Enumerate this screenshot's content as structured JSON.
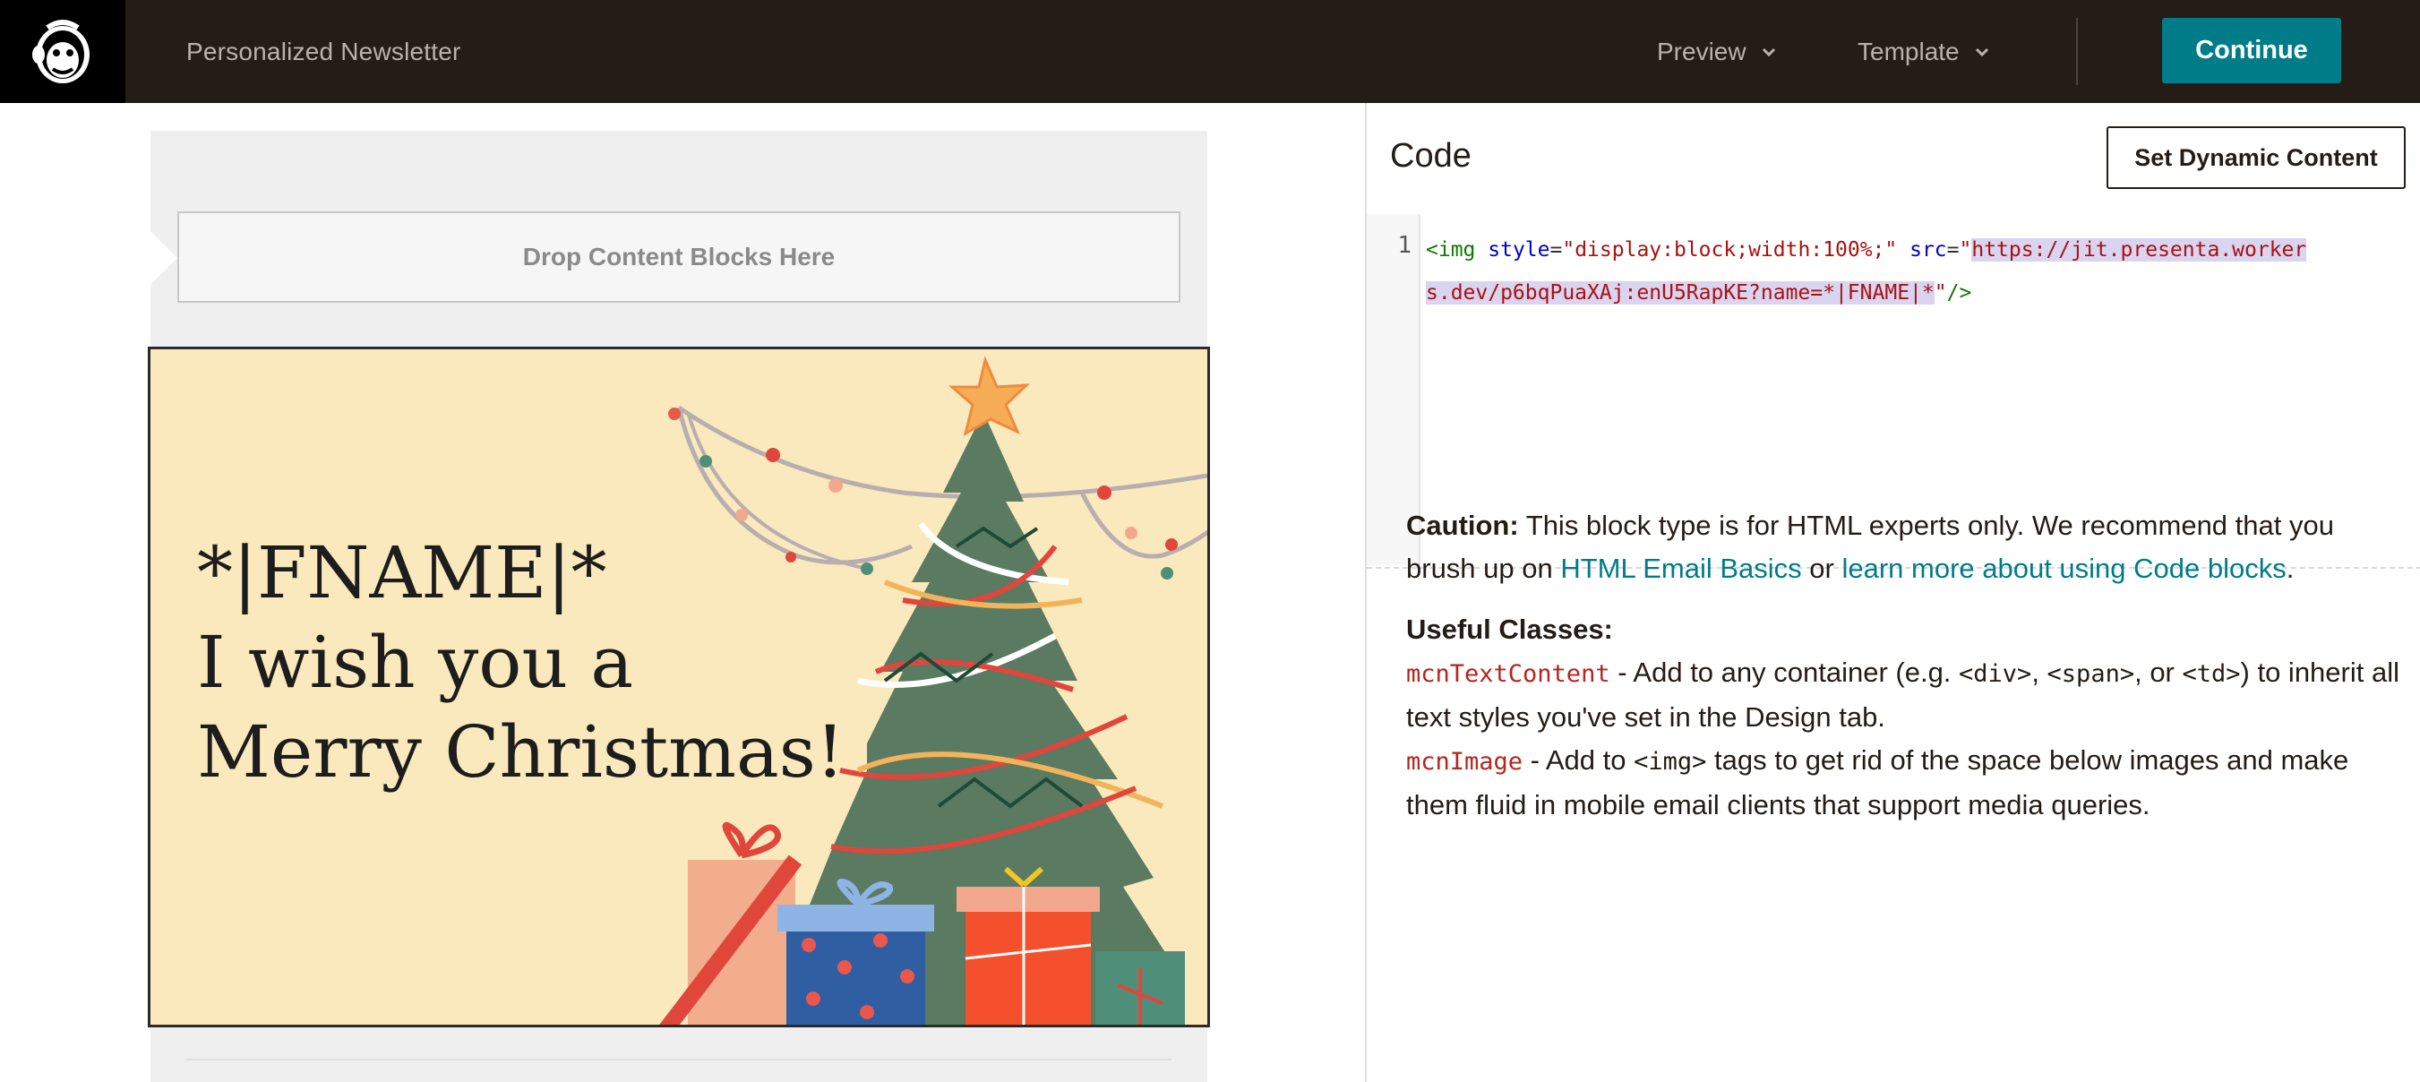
{
  "header": {
    "campaign_title": "Personalized Newsletter",
    "preview_label": "Preview",
    "template_label": "Template",
    "continue_label": "Continue",
    "brand_color": "#241c15",
    "accent_color": "#007c89"
  },
  "canvas": {
    "drop_zone_label": "Drop Content Blocks Here",
    "greeting_line1": "*|FNAME|*",
    "greeting_line2": "I wish you a",
    "greeting_line3": "Merry Christmas!",
    "card_background": "#f9e9bc"
  },
  "code_panel": {
    "title": "Code",
    "dynamic_button_label": "Set Dynamic Content",
    "line_number": "1",
    "code_tag_open": "<img",
    "code_attr_style": "style",
    "code_eq1": "=",
    "code_style_value": "\"display:block;width:100%;\"",
    "code_attr_src": "src",
    "code_eq2": "=",
    "code_src_quote": "\"",
    "code_src_line1": "https://jit.presenta.worker",
    "code_src_line2": "s.dev/p6bqPuaXAj:enU5RapKE?name=*|FNAME|*",
    "code_src_close_quote": "\"",
    "code_tag_close": "/>"
  },
  "help": {
    "caution_label": "Caution:",
    "caution_text": " This block type is for HTML experts only. We recommend that you brush up on ",
    "link_basics": "HTML Email Basics",
    "or_text": " or ",
    "link_code_blocks": "learn more about using Code blocks",
    "period": ".",
    "useful_classes_label": "Useful Classes:",
    "class1_name": "mcnTextContent",
    "class1_text_a": " - Add to any container (e.g. ",
    "class1_div": "<div>",
    "class1_sep1": ", ",
    "class1_span": "<span>",
    "class1_sep2": ", or ",
    "class1_td": "<td>",
    "class1_text_b": ") to inherit all text styles you've set in the Design tab.",
    "class2_name": "mcnImage",
    "class2_text_a": " - Add to ",
    "class2_img": "<img>",
    "class2_text_b": " tags to get rid of the space below images and make them fluid in mobile email clients that support media queries."
  }
}
